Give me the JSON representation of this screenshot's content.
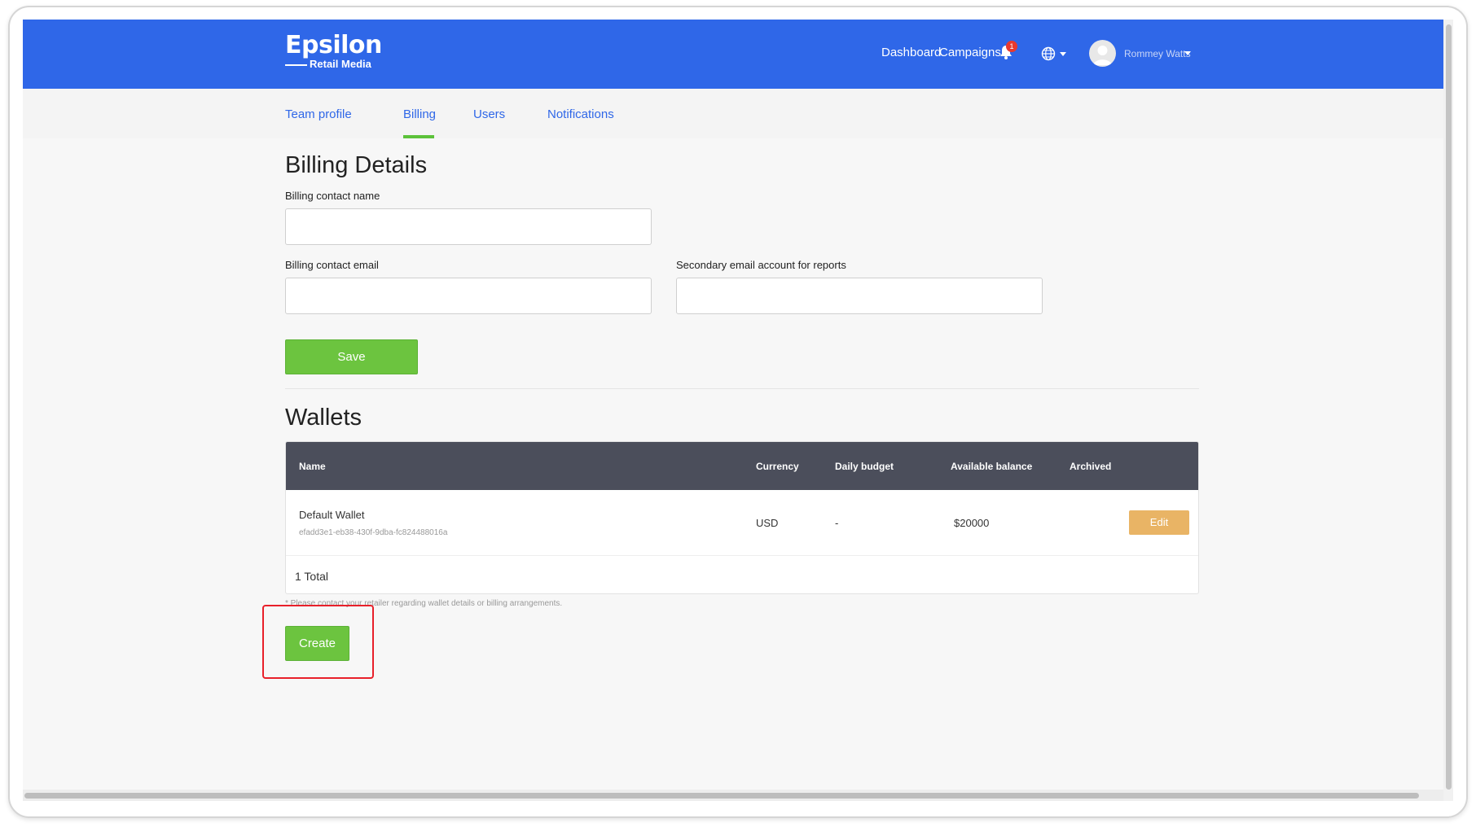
{
  "header": {
    "logo_main": "Epsilon",
    "logo_sub": "Retail Media",
    "nav": {
      "dashboard": "Dashboard",
      "campaigns": "Campaigns",
      "campaigns_badge": "1"
    },
    "user_name": "Rommey Watts",
    "icons": [
      "bell-icon",
      "globe-icon",
      "user-avatar-icon"
    ]
  },
  "tabs": {
    "items": [
      "Team profile",
      "Billing",
      "Users",
      "Notifications"
    ],
    "active": "Billing"
  },
  "billing": {
    "title": "Billing Details",
    "contact_name_label": "Billing contact name",
    "contact_name_value": "",
    "contact_email_label": "Billing contact email",
    "contact_email_value": "",
    "secondary_email_label": "Secondary email account for reports",
    "secondary_email_value": "",
    "save_label": "Save"
  },
  "wallets": {
    "title": "Wallets",
    "columns": {
      "name": "Name",
      "currency": "Currency",
      "daily_budget": "Daily budget",
      "available_balance": "Available balance",
      "archived": "Archived"
    },
    "rows": [
      {
        "name": "Default Wallet",
        "id": "efadd3e1-eb38-430f-9dba-fc824488016a",
        "currency": "USD",
        "daily_budget": "-",
        "available_balance": "$20000",
        "edit_label": "Edit"
      }
    ],
    "total": "1 Total",
    "note": "* Please contact your retailer regarding wallet details or billing arrangements.",
    "create_label": "Create"
  },
  "colors": {
    "brand_blue": "#2f67e8",
    "green": "#6cc43f",
    "edit_orange": "#e9b465",
    "table_header": "#4b4e5b",
    "highlight_red": "#e8202a"
  }
}
